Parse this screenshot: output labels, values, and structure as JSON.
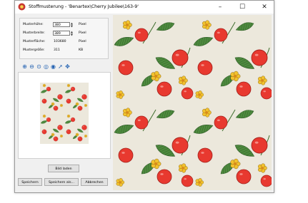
{
  "window": {
    "title": "Stoffmusterung - 'Benartex\\Cherry Jubilee\\163-9'",
    "minimize": "–",
    "maximize": "☐",
    "close": "✕"
  },
  "fields": {
    "height_label": "Musterhöhe:",
    "height_value": "380",
    "height_unit": "Pixel",
    "width_label": "Musterbreite:",
    "width_value": "389",
    "width_unit": "Pixel",
    "area_label": "Musterfläche:",
    "area_value": "103680",
    "area_unit": "Pixel",
    "size_label": "Mustergröße:",
    "size_value": "311",
    "size_unit": "KB"
  },
  "toolbar": {
    "icons": [
      "zoom-in-icon",
      "zoom-out-icon",
      "zoom-fit-icon",
      "zoom-actual-icon",
      "zoom-window-icon",
      "pointer-icon",
      "pan-icon"
    ]
  },
  "buttons": {
    "load": "Bild laden",
    "save": "Speichern",
    "save_as": "Speichern als...",
    "cancel": "Abbrechen"
  },
  "colors": {
    "fabric_background": "#ece8dc",
    "cherry": "#e8392f",
    "leaf": "#4e8a3e",
    "flower": "#f2c12e",
    "accent": "#1f5fb0"
  }
}
